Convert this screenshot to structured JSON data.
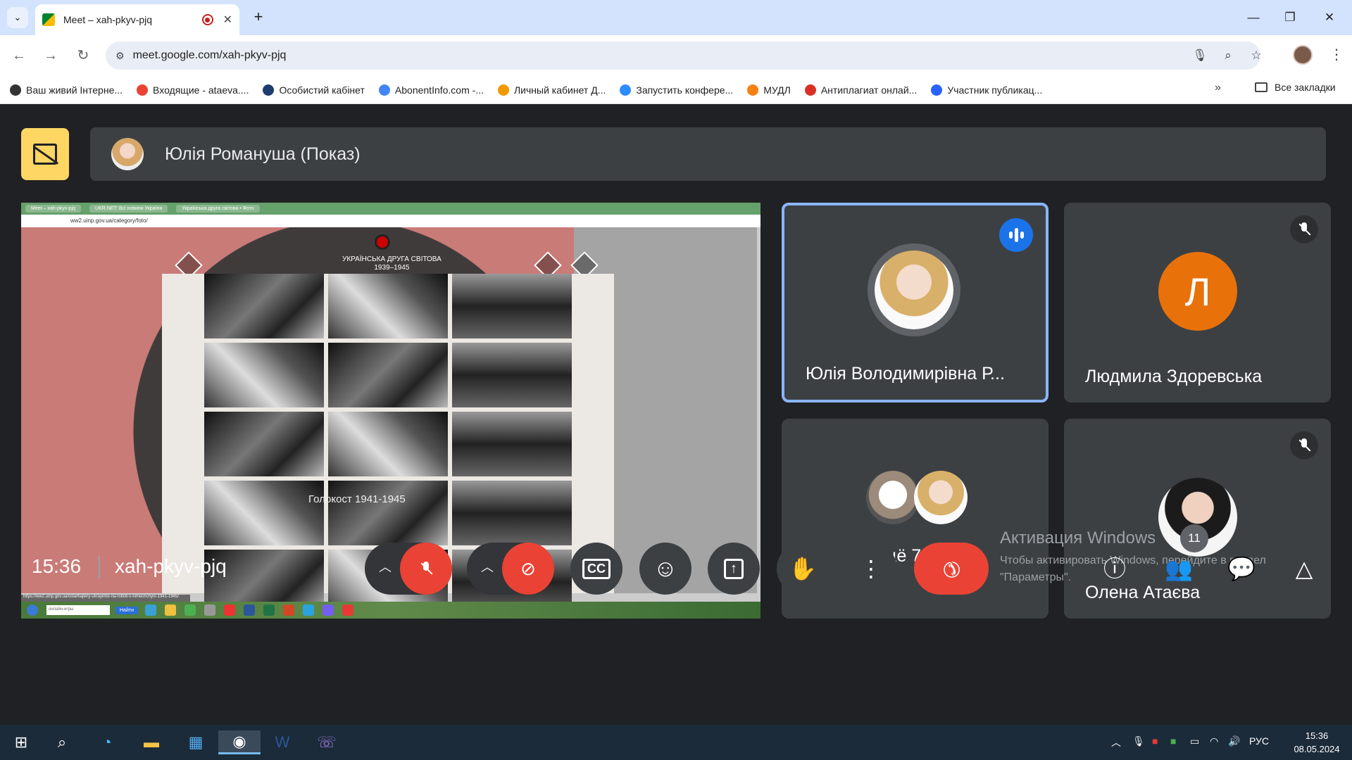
{
  "browser": {
    "tab_title": "Meet – xah-pkyv-pjq",
    "url": "meet.google.com/xah-pkyv-pjq",
    "bookmarks": [
      {
        "label": "Ваш живий Інтерне...",
        "icon": "24-icon",
        "color": "#333333"
      },
      {
        "label": "Входящие - ataeva....",
        "icon": "gmail-icon",
        "color": "#ea4335"
      },
      {
        "label": "Особистий кабінет",
        "icon": "globe-icon",
        "color": "#1f3c6e"
      },
      {
        "label": "AbonentInfo.com -...",
        "icon": "grid-icon",
        "color": "#4285f4"
      },
      {
        "label": "Личный кабинет Д...",
        "icon": "y-icon",
        "color": "#f29900"
      },
      {
        "label": "Запустить конфере...",
        "icon": "z-icon",
        "color": "#2d8cff"
      },
      {
        "label": "МУДЛ",
        "icon": "m-icon",
        "color": "#f98012"
      },
      {
        "label": "Антиплагиат онлай...",
        "icon": "c-icon",
        "color": "#d93025"
      },
      {
        "label": "Участник публикац...",
        "icon": "zm-icon",
        "color": "#2962ff"
      }
    ],
    "all_bookmarks": "Все закладки"
  },
  "meet": {
    "presenter": "Юлія Романуша (Показ)",
    "shared": {
      "site_title": "УКРАЇНСЬКА ДРУГА СВІТОВА",
      "site_years": "1939–1945",
      "address": "ww2.uinp.gov.ua/category/foto/",
      "overlay_text": "Голокост 1941-1945",
      "status_url": "https://ww2.uinp.gov.ua/ostarbajtery-ukrayintsi-na-roboti-v-nimechchyni-1941-1945/",
      "search_placeholder": "онлайн-игры",
      "search_button": "Найти"
    },
    "tiles": [
      {
        "name": "Юлія Володимирівна Р...",
        "state": "speaking"
      },
      {
        "name": "Людмила Здоревська",
        "initial": "Л",
        "state": "muted"
      },
      {
        "name": "Ещё 7 чел."
      },
      {
        "name": "Олена Атаєва",
        "state": "muted"
      }
    ],
    "time": "15:36",
    "code": "xah-pkyv-pjq",
    "activation_title": "Активация Windows",
    "activation_text_1": "Чтобы активировать Windows, перейдите в раздел",
    "activation_text_2": "\"Параметры\".",
    "participants_count": "11"
  },
  "taskbar": {
    "lang": "РУС",
    "time": "15:36",
    "date": "08.05.2024"
  },
  "colors": {
    "end_call": "#ea4335",
    "accent": "#8ab4f8",
    "presenting": "#fdd663"
  }
}
